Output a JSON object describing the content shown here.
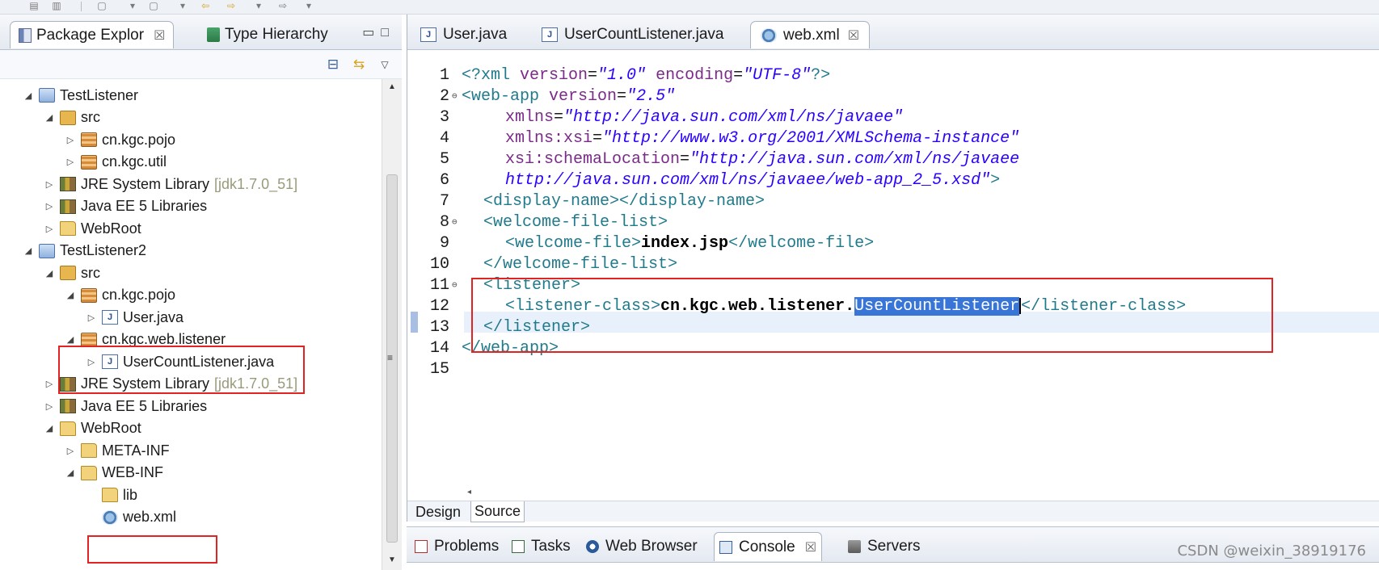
{
  "package_explorer": {
    "tabs": [
      {
        "label": "Package Explor",
        "icon": "package-explorer-icon",
        "active": true
      },
      {
        "label": "Type Hierarchy",
        "icon": "type-hierarchy-icon",
        "active": false
      }
    ],
    "tree": [
      {
        "label": "TestListener",
        "level": 0,
        "icon": "project-icon",
        "expanded": true
      },
      {
        "label": "src",
        "level": 1,
        "icon": "source-folder-icon",
        "expanded": true
      },
      {
        "label": "cn.kgc.pojo",
        "level": 2,
        "icon": "package-icon",
        "expanded": false
      },
      {
        "label": "cn.kgc.util",
        "level": 2,
        "icon": "package-icon",
        "expanded": false
      },
      {
        "label": "JRE System Library",
        "suffix": "[jdk1.7.0_51]",
        "level": 1,
        "icon": "library-icon",
        "expanded": false
      },
      {
        "label": "Java EE 5 Libraries",
        "level": 1,
        "icon": "library-icon",
        "expanded": false
      },
      {
        "label": "WebRoot",
        "level": 1,
        "icon": "folder-icon",
        "expanded": false
      },
      {
        "label": "TestListener2",
        "level": 0,
        "icon": "project-icon",
        "expanded": true
      },
      {
        "label": "src",
        "level": 1,
        "icon": "source-folder-icon",
        "expanded": true
      },
      {
        "label": "cn.kgc.pojo",
        "level": 2,
        "icon": "package-icon",
        "expanded": true
      },
      {
        "label": "User.java",
        "level": 3,
        "icon": "java-file-icon",
        "expanded": false
      },
      {
        "label": "cn.kgc.web.listener",
        "level": 2,
        "icon": "package-icon",
        "expanded": true
      },
      {
        "label": "UserCountListener.java",
        "level": 3,
        "icon": "java-file-icon",
        "expanded": false
      },
      {
        "label": "JRE System Library",
        "suffix": "[jdk1.7.0_51]",
        "level": 1,
        "icon": "library-icon",
        "expanded": false
      },
      {
        "label": "Java EE 5 Libraries",
        "level": 1,
        "icon": "library-icon",
        "expanded": false
      },
      {
        "label": "WebRoot",
        "level": 1,
        "icon": "folder-icon",
        "expanded": true
      },
      {
        "label": "META-INF",
        "level": 2,
        "icon": "folder-icon",
        "expanded": false
      },
      {
        "label": "WEB-INF",
        "level": 2,
        "icon": "folder-icon",
        "expanded": true
      },
      {
        "label": "lib",
        "level": 3,
        "icon": "folder-icon",
        "expanded": null
      },
      {
        "label": "web.xml",
        "level": 3,
        "icon": "xml-file-icon",
        "expanded": null
      }
    ]
  },
  "editor": {
    "tabs": [
      {
        "label": "User.java",
        "icon": "java-file-icon",
        "active": false
      },
      {
        "label": "UserCountListener.java",
        "icon": "java-file-icon",
        "active": false
      },
      {
        "label": "web.xml",
        "icon": "xml-file-icon",
        "active": true
      }
    ],
    "lines": [
      {
        "n": "1",
        "fold": false
      },
      {
        "n": "2",
        "fold": true
      },
      {
        "n": "3",
        "fold": false
      },
      {
        "n": "4",
        "fold": false
      },
      {
        "n": "5",
        "fold": false
      },
      {
        "n": "6",
        "fold": false
      },
      {
        "n": "7",
        "fold": false
      },
      {
        "n": "8",
        "fold": true
      },
      {
        "n": "9",
        "fold": false
      },
      {
        "n": "10",
        "fold": false
      },
      {
        "n": "11",
        "fold": true
      },
      {
        "n": "12",
        "fold": false
      },
      {
        "n": "13",
        "fold": false
      },
      {
        "n": "14",
        "fold": false
      },
      {
        "n": "15",
        "fold": false
      }
    ],
    "code": {
      "l1": {
        "a": "<?xml ",
        "b": "version",
        "c": "=",
        "d": "\"1.0\"",
        "e": " ",
        "f": "encoding",
        "g": "=",
        "h": "\"UTF-8\"",
        "i": "?>"
      },
      "l2": {
        "a": "<web-app ",
        "b": "version",
        "c": "=",
        "d": "\"2.5\""
      },
      "l3": {
        "a": "xmlns",
        "b": "=",
        "c": "\"http://java.sun.com/xml/ns/javaee\""
      },
      "l4": {
        "a": "xmlns:xsi",
        "b": "=",
        "c": "\"http://www.w3.org/2001/XMLSchema-instance\""
      },
      "l5": {
        "a": "xsi:schemaLocation",
        "b": "=",
        "c": "\"http://java.sun.com/xml/ns/javaee"
      },
      "l6": {
        "a": "http://java.sun.com/xml/ns/javaee/web-app_2_5.xsd\"",
        "b": ">"
      },
      "l7": {
        "a": "<display-name></display-name>"
      },
      "l8": {
        "a": "<welcome-file-list>"
      },
      "l9": {
        "a": "<welcome-file>",
        "b": "index.jsp",
        "c": "</welcome-file>"
      },
      "l10": {
        "a": "</welcome-file-list>"
      },
      "l11": {
        "a": "<listener>"
      },
      "l12": {
        "a": "<listener-class>",
        "b": "cn.kgc.web.listener.",
        "c": "UserCountListener",
        "d": "</listener-class>"
      },
      "l13": {
        "a": "</listener>"
      },
      "l14": {
        "a": "</web-app>"
      }
    },
    "view_tabs": [
      {
        "label": "Design",
        "active": false
      },
      {
        "label": "Source",
        "active": true
      }
    ]
  },
  "console": {
    "tabs": [
      {
        "label": "Problems",
        "icon": "problems-icon",
        "active": false
      },
      {
        "label": "Tasks",
        "icon": "tasks-icon",
        "active": false
      },
      {
        "label": "Web Browser",
        "icon": "web-browser-icon",
        "active": false
      },
      {
        "label": "Console",
        "icon": "console-icon",
        "active": true
      },
      {
        "label": "Servers",
        "icon": "servers-icon",
        "active": false
      }
    ]
  },
  "watermark": "CSDN @weixin_38919176",
  "colors": {
    "highlight_box": "#e02424",
    "selection": "#3875d7",
    "xml_tag": "#1f7a8c",
    "xml_attr": "#7b2a8a",
    "xml_string": "#2a00ff"
  }
}
